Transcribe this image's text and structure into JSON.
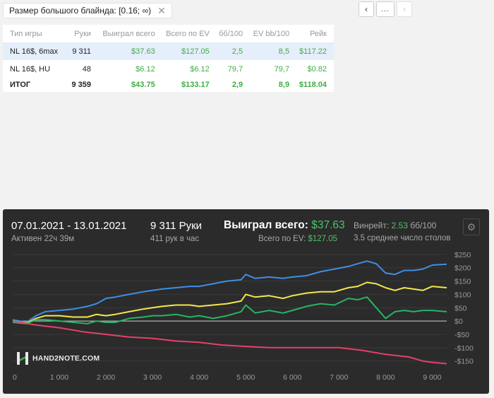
{
  "filter": {
    "label": "Размер большого блайнда: [0.16; ∞)",
    "close_glyph": "✕"
  },
  "nav": {
    "prev": "‹",
    "more": "...",
    "next": "›"
  },
  "table": {
    "headers": [
      "Тип игры",
      "Руки",
      "Выиграл всего",
      "Всего по EV",
      "бб/100",
      "EV bb/100",
      "Рейк"
    ],
    "rows": [
      [
        "NL 16$, 6max",
        "9 311",
        "$37.63",
        "$127.05",
        "2,5",
        "8,5",
        "$117.22"
      ],
      [
        "NL 16$, HU",
        "48",
        "$6.12",
        "$6.12",
        "79,7",
        "79,7",
        "$0.82"
      ]
    ],
    "total": [
      "ИТОГ",
      "9 359",
      "$43.75",
      "$133.17",
      "2,9",
      "8,9",
      "$118.04"
    ]
  },
  "summary": {
    "date_range": "07.01.2021 - 13.01.2021",
    "active": "Активен 22ч 39м",
    "hands": "9 311 Руки",
    "hands_per_hour": "411 рук в час",
    "won_label": "Выиграл всего:",
    "won_value": "$37.63",
    "ev_label": "Всего по EV:",
    "ev_value": "$127.05",
    "winrate_label": "Винрейт:",
    "winrate_value": "2.53",
    "winrate_unit": "бб/100",
    "tables": "3.5 среднее число столов"
  },
  "logo": {
    "text": "HAND2NOTE.COM"
  },
  "chart_data": {
    "type": "line",
    "x_ticks": [
      "0",
      "1 000",
      "2 000",
      "3 000",
      "4 000",
      "5 000",
      "6 000",
      "7 000",
      "8 000",
      "9 000"
    ],
    "y_ticks": [
      "$250",
      "$200",
      "$150",
      "$100",
      "$50",
      "$0",
      "-$50",
      "-$100",
      "-$150"
    ],
    "xlim": [
      0,
      9311
    ],
    "ylim": [
      -180,
      255
    ],
    "colors": {
      "blue": "#3f8ee6",
      "yellow": "#f3e84c",
      "green": "#28b464",
      "red": "#e6406a"
    },
    "series": [
      {
        "color": "blue",
        "x": [
          0,
          300,
          500,
          700,
          1000,
          1300,
          1600,
          1800,
          2000,
          2200,
          2500,
          2800,
          3000,
          3200,
          3500,
          3800,
          4000,
          4300,
          4600,
          4900,
          5000,
          5200,
          5500,
          5800,
          6000,
          6300,
          6600,
          6900,
          7200,
          7400,
          7600,
          7800,
          8000,
          8200,
          8400,
          8600,
          8800,
          9000,
          9311
        ],
        "y": [
          5,
          -5,
          20,
          35,
          40,
          45,
          55,
          65,
          85,
          90,
          100,
          110,
          115,
          120,
          125,
          130,
          130,
          140,
          150,
          155,
          175,
          160,
          165,
          160,
          165,
          170,
          185,
          195,
          205,
          215,
          225,
          215,
          180,
          175,
          190,
          190,
          195,
          210,
          213
        ]
      },
      {
        "color": "yellow",
        "x": [
          0,
          300,
          500,
          700,
          1000,
          1300,
          1600,
          1800,
          2000,
          2200,
          2500,
          2800,
          3000,
          3200,
          3500,
          3800,
          4000,
          4300,
          4600,
          4900,
          5000,
          5200,
          5500,
          5800,
          6000,
          6300,
          6600,
          6900,
          7200,
          7400,
          7600,
          7800,
          8000,
          8200,
          8400,
          8600,
          8800,
          9000,
          9311
        ],
        "y": [
          0,
          -8,
          10,
          20,
          20,
          15,
          15,
          25,
          20,
          25,
          35,
          45,
          50,
          55,
          60,
          60,
          55,
          60,
          65,
          75,
          100,
          90,
          95,
          85,
          95,
          105,
          110,
          110,
          125,
          130,
          145,
          140,
          125,
          115,
          125,
          120,
          115,
          130,
          125
        ]
      },
      {
        "color": "green",
        "x": [
          0,
          300,
          500,
          700,
          1000,
          1300,
          1600,
          1800,
          2000,
          2200,
          2500,
          2800,
          3000,
          3200,
          3500,
          3800,
          4000,
          4300,
          4600,
          4900,
          5000,
          5200,
          5500,
          5800,
          6000,
          6300,
          6600,
          6900,
          7200,
          7400,
          7600,
          7800,
          8000,
          8200,
          8400,
          8600,
          8800,
          9000,
          9311
        ],
        "y": [
          -5,
          -10,
          5,
          5,
          0,
          -5,
          -10,
          0,
          -5,
          -5,
          10,
          15,
          20,
          20,
          25,
          15,
          20,
          10,
          20,
          35,
          60,
          30,
          40,
          30,
          40,
          55,
          65,
          60,
          85,
          80,
          90,
          50,
          10,
          35,
          40,
          35,
          40,
          40,
          35
        ]
      },
      {
        "color": "red",
        "x": [
          0,
          500,
          1000,
          1500,
          2000,
          2500,
          3000,
          3500,
          4000,
          4500,
          5000,
          5500,
          6000,
          6500,
          7000,
          7500,
          8000,
          8500,
          8800,
          9000,
          9311
        ],
        "y": [
          0,
          -15,
          -25,
          -40,
          -50,
          -60,
          -65,
          -75,
          -80,
          -90,
          -95,
          -100,
          -100,
          -100,
          -100,
          -110,
          -125,
          -135,
          -150,
          -155,
          -160
        ]
      }
    ]
  }
}
